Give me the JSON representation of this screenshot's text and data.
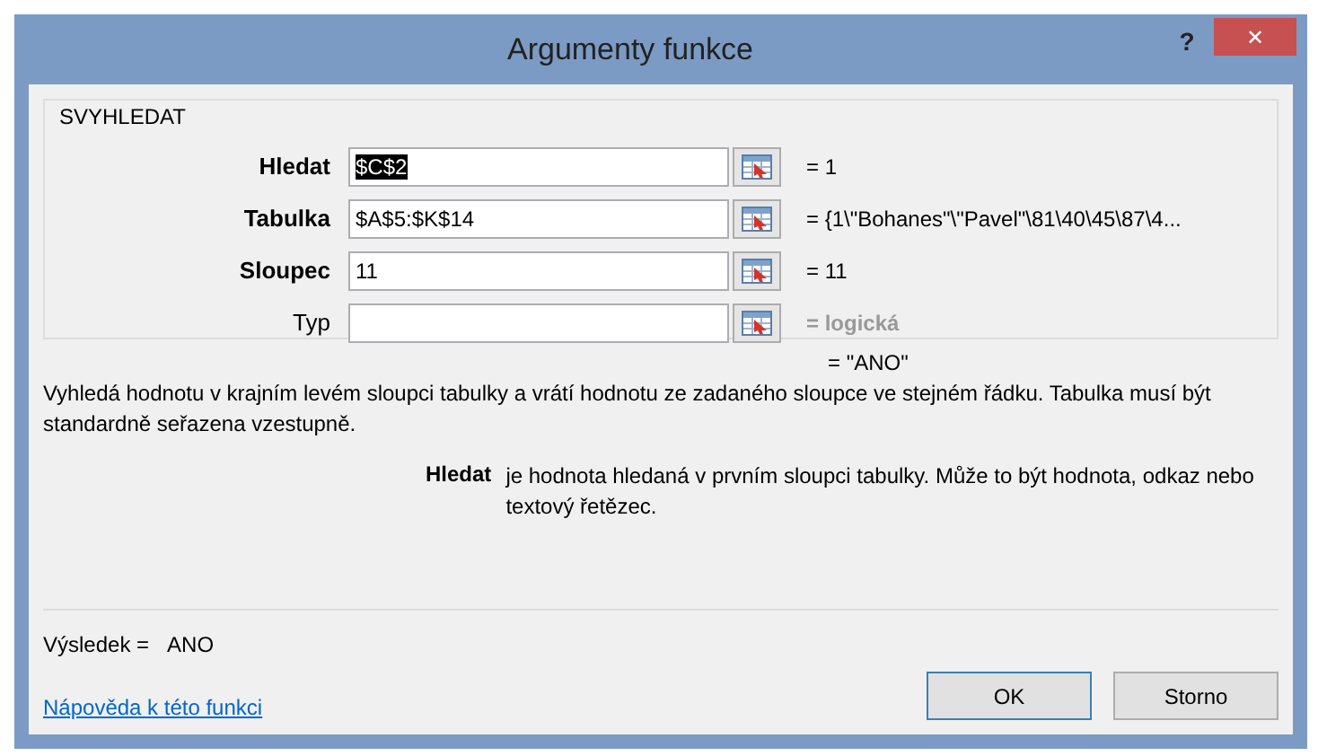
{
  "window": {
    "title": "Argumenty funkce",
    "help_button": "?",
    "close_button": "✕"
  },
  "function": {
    "name": "SVYHLEDAT",
    "arguments": [
      {
        "label": "Hledat",
        "required": true,
        "value": "$C$2",
        "text_selected": true,
        "result": "= 1",
        "greyed": false
      },
      {
        "label": "Tabulka",
        "required": true,
        "value": "$A$5:$K$14",
        "result": "= {1\\\"Bohanes\"\\\"Pavel\"\\81\\40\\45\\87\\4...",
        "greyed": false
      },
      {
        "label": "Sloupec",
        "required": true,
        "value": "11",
        "result": "= 11",
        "greyed": false
      },
      {
        "label": "Typ",
        "required": false,
        "result": "= logická",
        "greyed": true
      }
    ]
  },
  "formula_result": "= \"ANO\"",
  "description": "Vyhledá hodnotu v krajním levém sloupci tabulky a vrátí hodnotu ze zadaného sloupce ve stejném řádku. Tabulka musí být standardně seřazena vzestupně.",
  "argument_help": {
    "name": "Hledat",
    "text": "je hodnota hledaná v prvním sloupci tabulky. Může to být hodnota, odkaz nebo textový řetězec."
  },
  "result": {
    "label": "Výsledek =",
    "value": "ANO"
  },
  "help_link": "Nápověda k této funkci",
  "buttons": [
    {
      "label": "OK",
      "default": true
    },
    {
      "label": "Storno",
      "default": false
    }
  ]
}
